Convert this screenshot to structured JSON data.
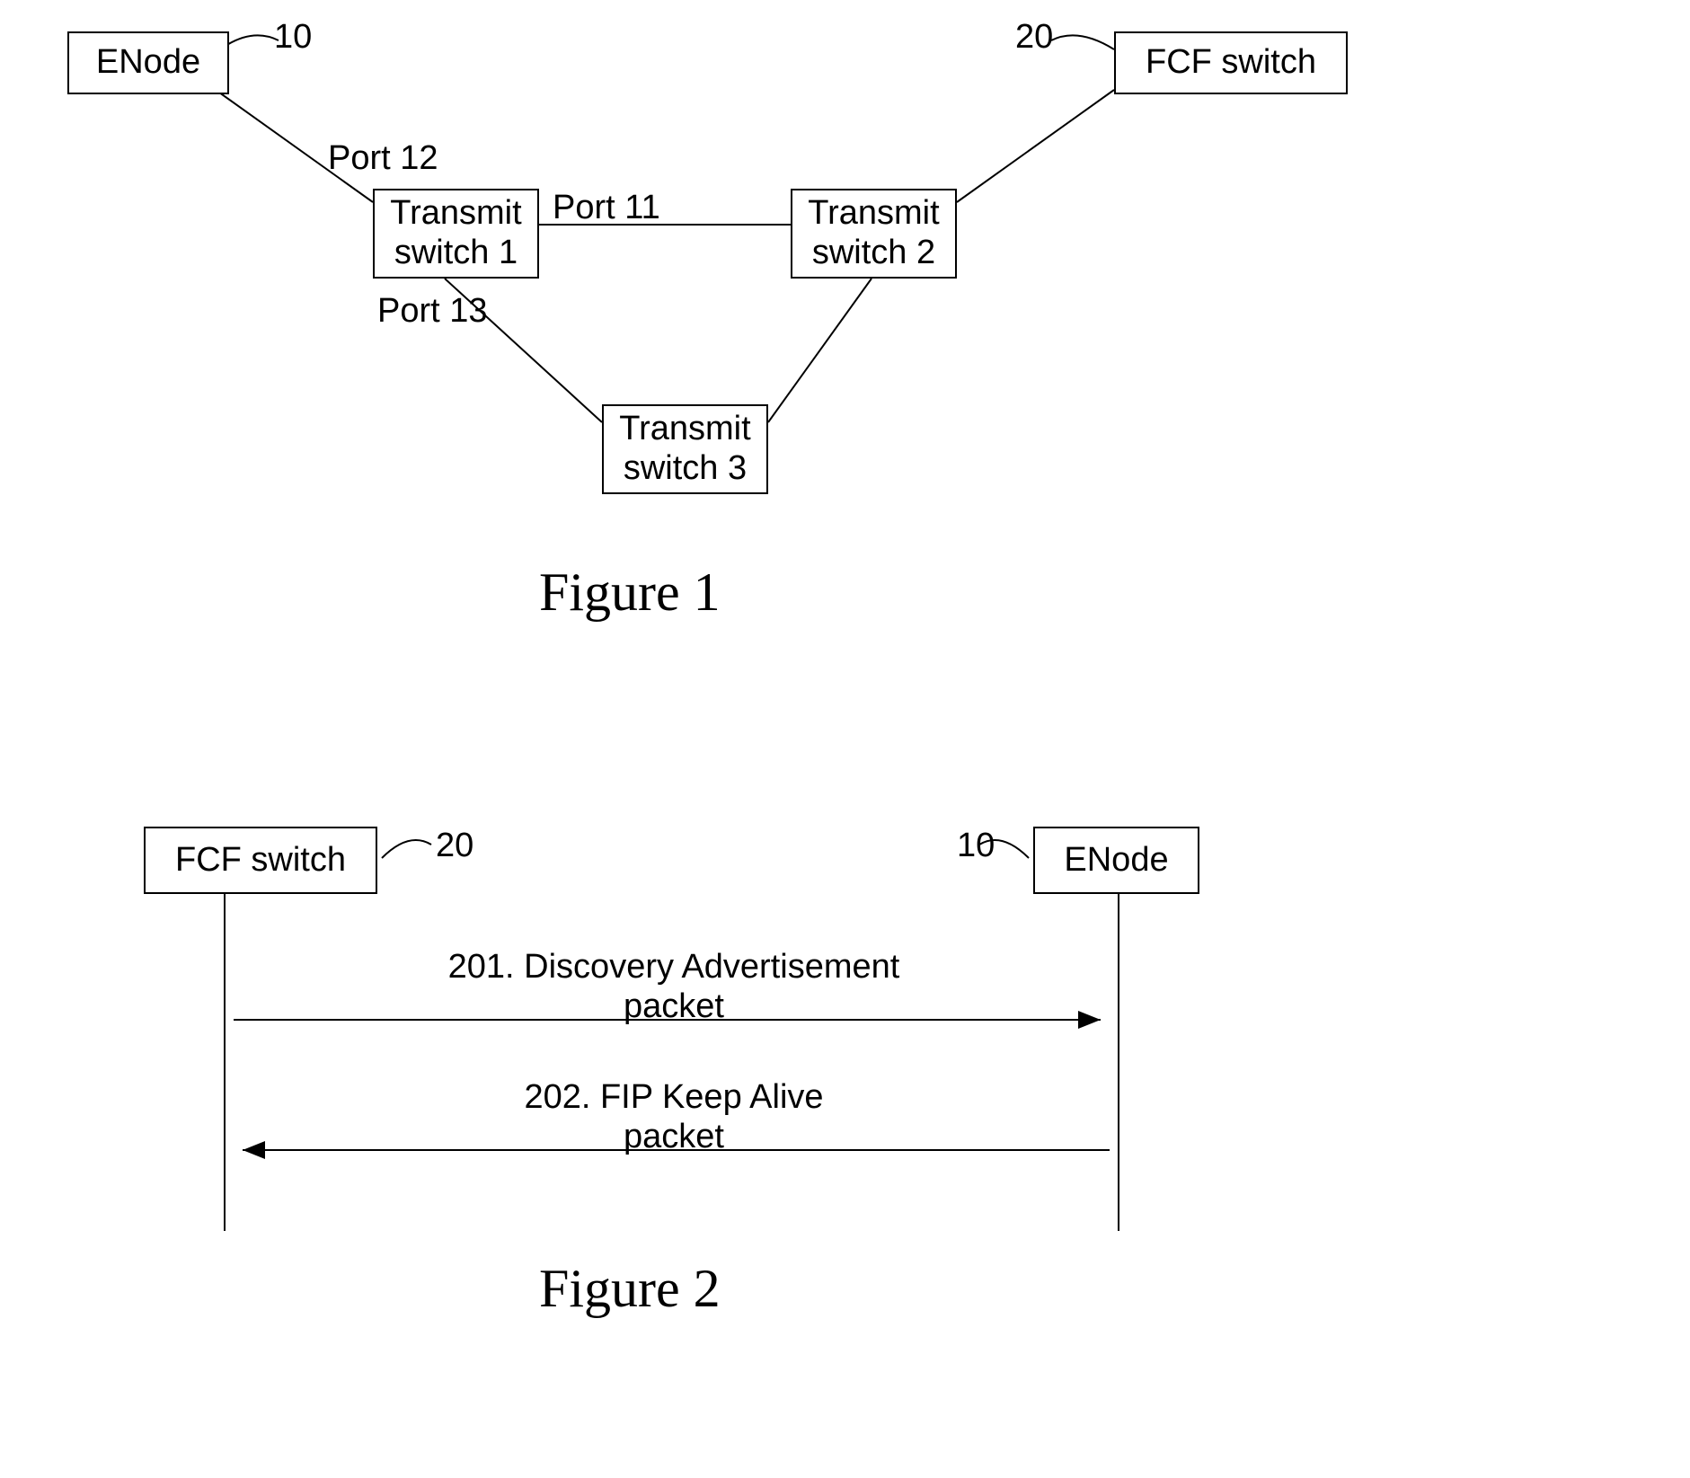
{
  "figure1": {
    "caption": "Figure 1",
    "nodes": {
      "enode": {
        "label": "ENode",
        "tag": "10"
      },
      "fcf": {
        "label": "FCF switch",
        "tag": "20"
      },
      "ts1": {
        "label": "Transmit\nswitch 1"
      },
      "ts2": {
        "label": "Transmit\nswitch 2"
      },
      "ts3": {
        "label": "Transmit\nswitch 3"
      }
    },
    "ports": {
      "p11": "Port 11",
      "p12": "Port 12",
      "p13": "Port 13"
    }
  },
  "figure2": {
    "caption": "Figure 2",
    "nodes": {
      "fcf": {
        "label": "FCF switch",
        "tag": "20"
      },
      "enode": {
        "label": "ENode",
        "tag": "10"
      }
    },
    "messages": {
      "m201": "201. Discovery Advertisement\npacket",
      "m202": "202. FIP Keep Alive\npacket"
    }
  },
  "chart_data": [
    {
      "type": "diagram",
      "title": "Figure 1",
      "nodes": [
        {
          "id": "ENode",
          "tag": "10"
        },
        {
          "id": "FCF switch",
          "tag": "20"
        },
        {
          "id": "Transmit switch 1"
        },
        {
          "id": "Transmit switch 2"
        },
        {
          "id": "Transmit switch 3"
        }
      ],
      "edges": [
        {
          "from": "ENode",
          "to": "Transmit switch 1",
          "port": "Port 12"
        },
        {
          "from": "Transmit switch 1",
          "to": "Transmit switch 2",
          "port": "Port 11"
        },
        {
          "from": "Transmit switch 1",
          "to": "Transmit switch 3",
          "port": "Port 13"
        },
        {
          "from": "Transmit switch 2",
          "to": "FCF switch"
        },
        {
          "from": "Transmit switch 2",
          "to": "Transmit switch 3"
        }
      ]
    },
    {
      "type": "diagram",
      "title": "Figure 2",
      "participants": [
        "FCF switch",
        "ENode"
      ],
      "tags": {
        "FCF switch": "20",
        "ENode": "10"
      },
      "messages": [
        {
          "from": "FCF switch",
          "to": "ENode",
          "label": "201. Discovery Advertisement packet"
        },
        {
          "from": "ENode",
          "to": "FCF switch",
          "label": "202. FIP Keep Alive packet"
        }
      ]
    }
  ]
}
